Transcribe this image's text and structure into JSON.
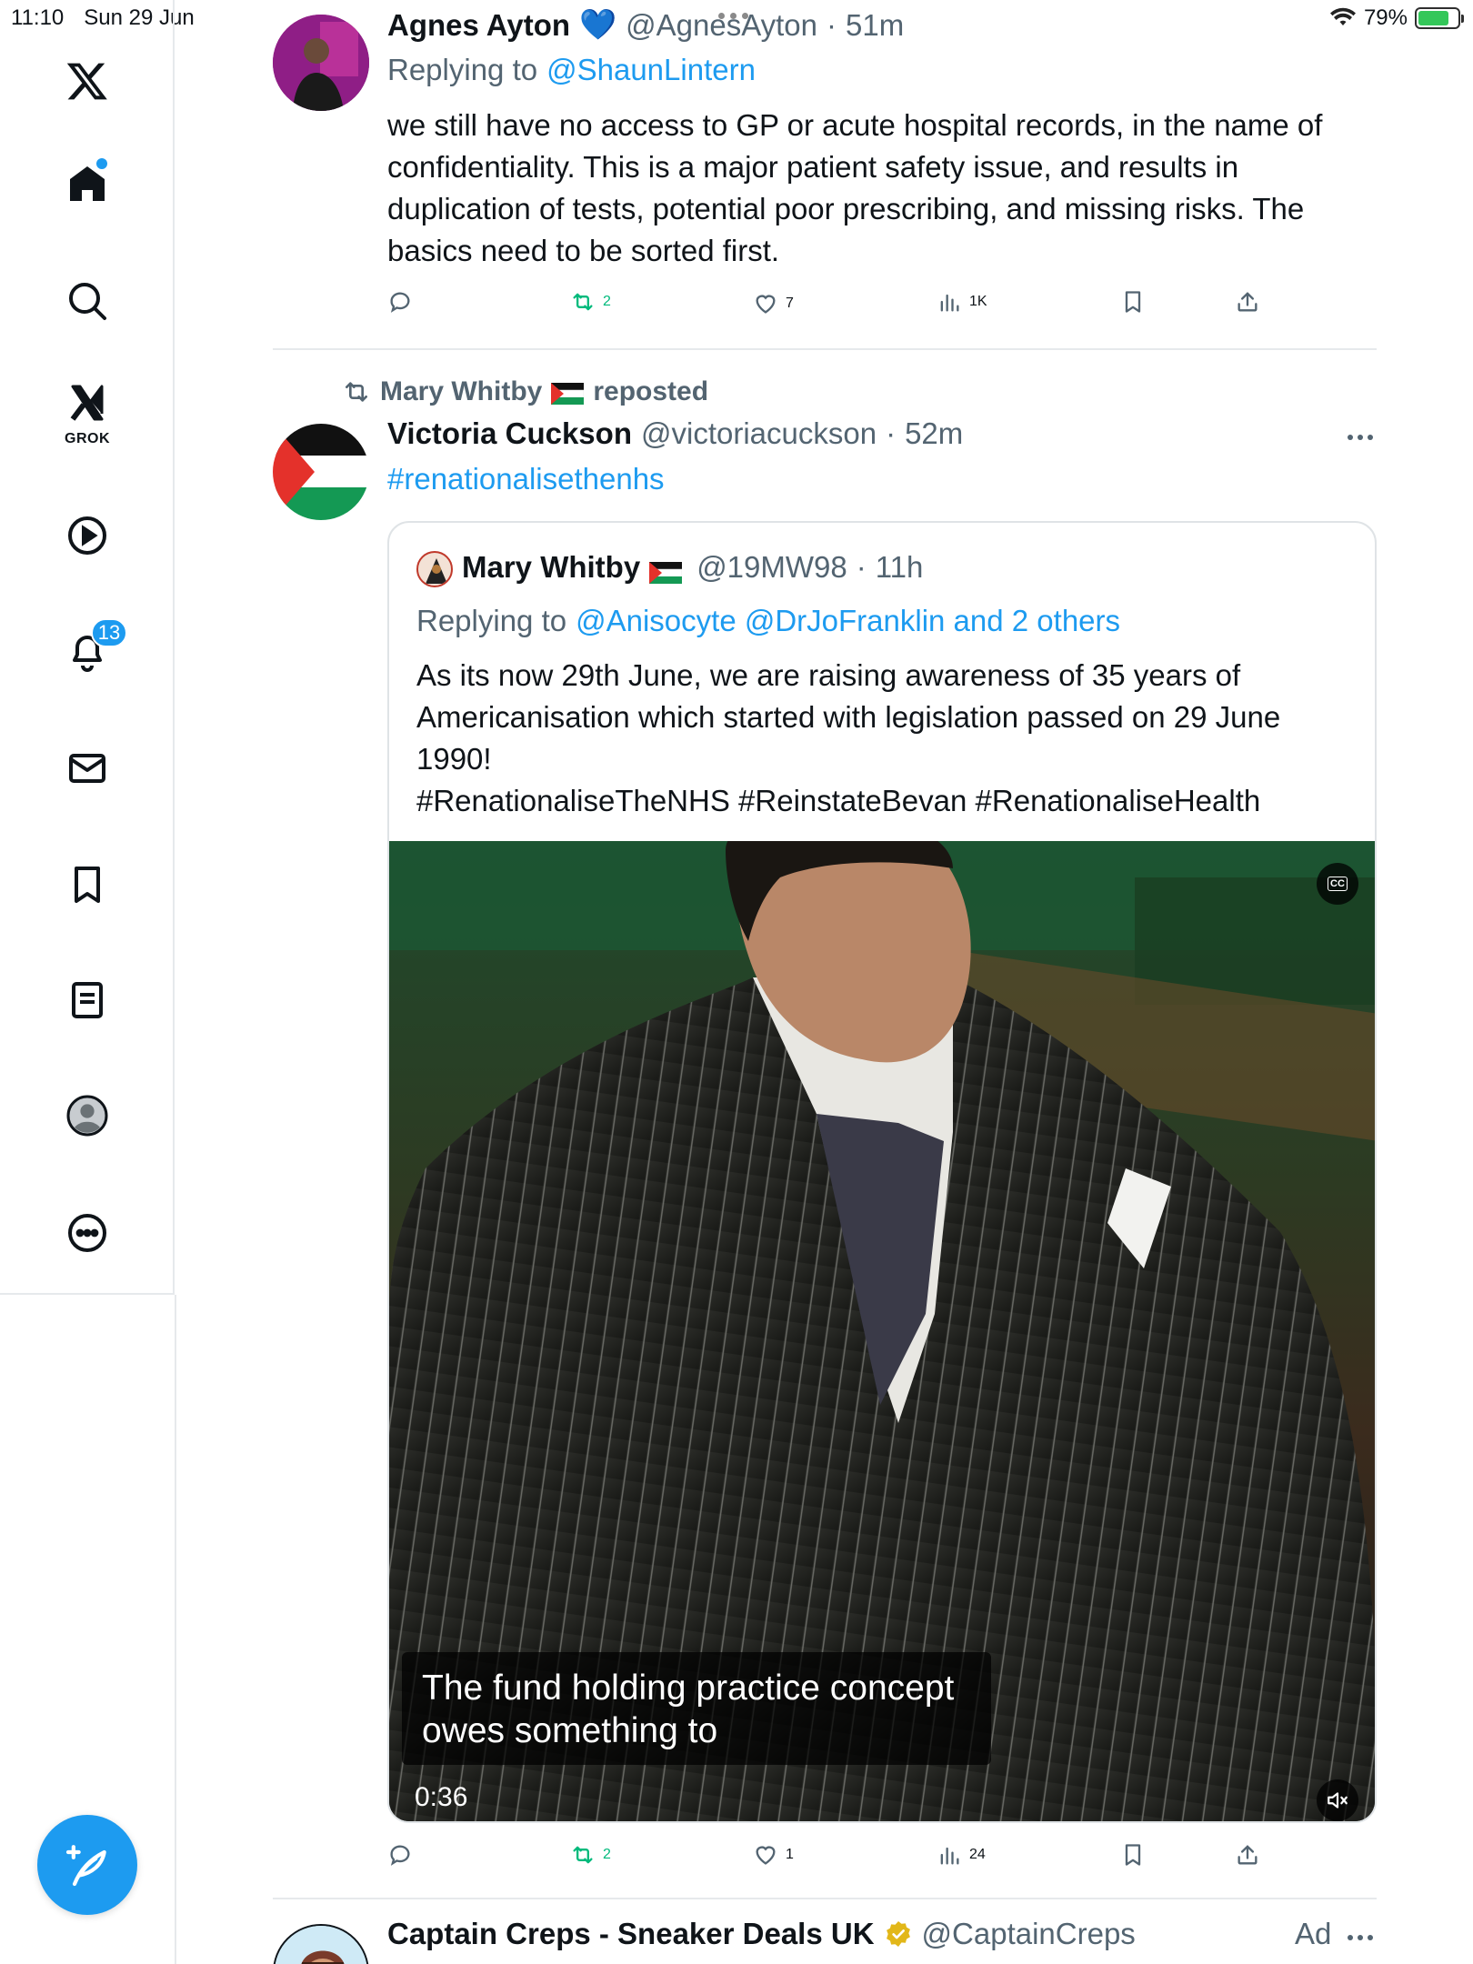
{
  "status_bar": {
    "time": "11:10",
    "date": "Sun 29 Jun",
    "battery": "79%",
    "battery_level": 0.79
  },
  "sidebar": {
    "grok_label": "GROK",
    "notifications_count": "13",
    "items": [
      "x-logo",
      "home",
      "search",
      "grok",
      "video",
      "notifications",
      "messages",
      "bookmarks",
      "lists",
      "profile",
      "more"
    ]
  },
  "tweet1": {
    "name": "Agnes Ayton",
    "name_emoji": "💙",
    "handle": "@AgnesAyton",
    "sep": "·",
    "time": "51m",
    "replying_to_label": "Replying to",
    "replying_to_handle": "@ShaunLintern",
    "text": "we still have no access to GP or acute hospital records, in the name of confidentiality. This is a major patient safety issue, and results in duplication of tests, potential poor prescribing, and missing risks. The basics  need to be sorted first.",
    "retweets": "2",
    "likes": "7",
    "views": "1K"
  },
  "tweet2": {
    "repost_by": "Mary Whitby",
    "repost_label": "reposted",
    "name": "Victoria Cuckson",
    "handle": "@victoriacuckson",
    "sep": "·",
    "time": "52m",
    "hashtag": "#renationalisethenhs",
    "retweets": "2",
    "likes": "1",
    "views": "24",
    "quote": {
      "name": "Mary Whitby",
      "handle": "@19MW98",
      "sep": "·",
      "time": "11h",
      "replying_to_label": "Replying to",
      "replying_to_handles": "@Anisocyte @DrJoFranklin and 2 others",
      "text_line1": "As its  now 29th June, we are raising awareness of 35 years of",
      "text_line2": "Americanisation which started with legislation passed on 29 June",
      "text_line3": "1990!",
      "hashtags": "#RenationaliseTheNHS #ReinstateBevan #RenationaliseHealth",
      "video": {
        "caption_line1": "The fund holding practice concept",
        "caption_line2": "owes something to",
        "duration": "0:36",
        "cc_label": "CC"
      }
    }
  },
  "tweet3": {
    "name": "Captain Creps - Sneaker Deals UK",
    "handle": "@CaptainCreps",
    "ad_label": "Ad"
  },
  "colors": {
    "accent": "#1d9bf0",
    "retweet_green": "#00ba7c",
    "muted": "#536471",
    "divider": "#e6e9ec"
  }
}
